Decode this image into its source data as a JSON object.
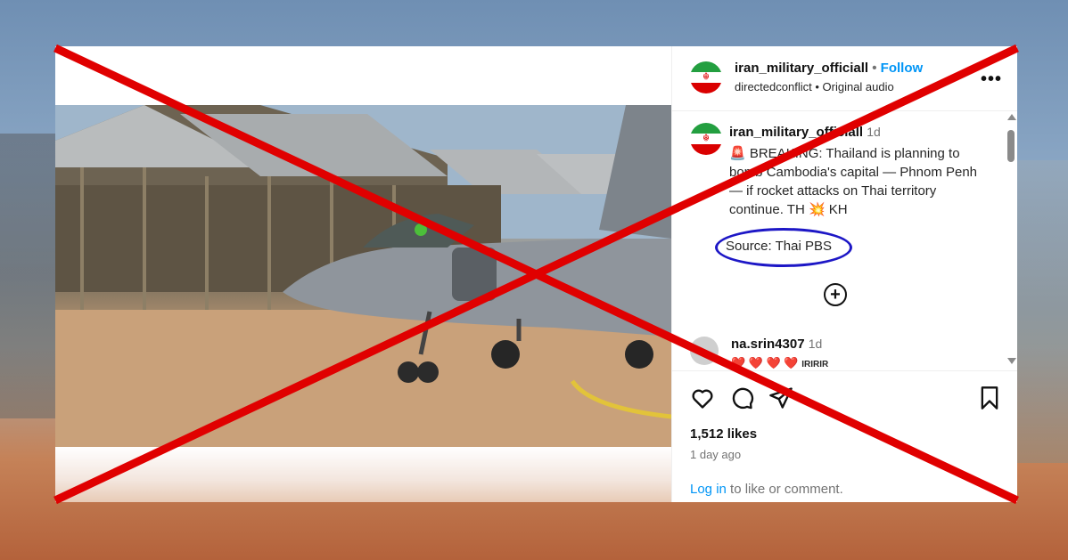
{
  "post": {
    "username": "iran_military_officiall",
    "follow_label": "Follow",
    "audio_source": "directedconflict",
    "audio_label": "Original audio",
    "more_label": "•••"
  },
  "caption": {
    "username": "iran_military_officiall",
    "time": "1d",
    "text": "🚨 BREAKING: Thailand is planning to bomb Cambodia's capital — Phnom Penh — if rocket attacks on Thai territory continue. TH 💥 KH",
    "source_text": "Source: Thai PBS"
  },
  "comment": {
    "username": "na.srin4307",
    "time": "1d",
    "hearts": "❤️ ❤️ ❤️ ❤️",
    "flags": "IRIRIR"
  },
  "stats": {
    "likes": "1,512 likes",
    "date": "1 day ago"
  },
  "login": {
    "link": "Log in",
    "rest": " to like or comment."
  },
  "icons": [
    "iran-flag-avatar",
    "more-icon",
    "add-comment-icon",
    "mute-icon",
    "heart-icon",
    "comment-icon",
    "share-icon",
    "bookmark-icon"
  ],
  "colors": {
    "accent": "#0095f6",
    "annotation_circle": "#1d17c6",
    "red_x": "#e00000"
  }
}
